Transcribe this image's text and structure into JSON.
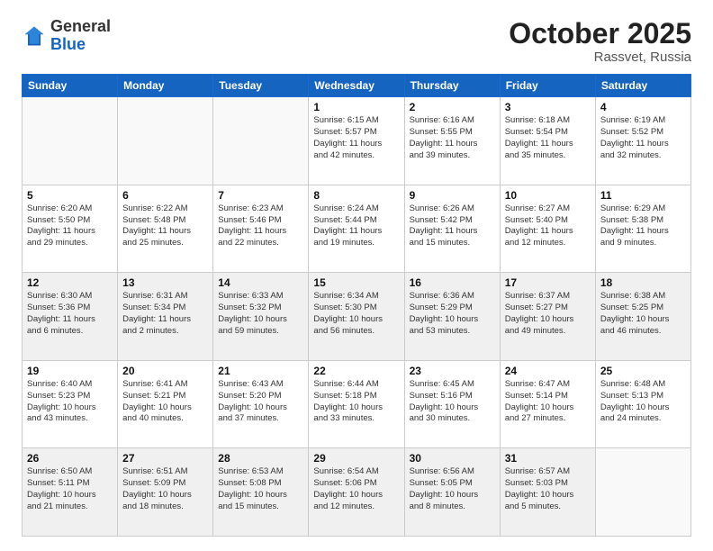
{
  "header": {
    "logo_general": "General",
    "logo_blue": "Blue",
    "month": "October 2025",
    "location": "Rassvet, Russia"
  },
  "weekdays": [
    "Sunday",
    "Monday",
    "Tuesday",
    "Wednesday",
    "Thursday",
    "Friday",
    "Saturday"
  ],
  "weeks": [
    [
      {
        "day": "",
        "text": "",
        "empty": true
      },
      {
        "day": "",
        "text": "",
        "empty": true
      },
      {
        "day": "",
        "text": "",
        "empty": true
      },
      {
        "day": "1",
        "text": "Sunrise: 6:15 AM\nSunset: 5:57 PM\nDaylight: 11 hours\nand 42 minutes."
      },
      {
        "day": "2",
        "text": "Sunrise: 6:16 AM\nSunset: 5:55 PM\nDaylight: 11 hours\nand 39 minutes."
      },
      {
        "day": "3",
        "text": "Sunrise: 6:18 AM\nSunset: 5:54 PM\nDaylight: 11 hours\nand 35 minutes."
      },
      {
        "day": "4",
        "text": "Sunrise: 6:19 AM\nSunset: 5:52 PM\nDaylight: 11 hours\nand 32 minutes."
      }
    ],
    [
      {
        "day": "5",
        "text": "Sunrise: 6:20 AM\nSunset: 5:50 PM\nDaylight: 11 hours\nand 29 minutes."
      },
      {
        "day": "6",
        "text": "Sunrise: 6:22 AM\nSunset: 5:48 PM\nDaylight: 11 hours\nand 25 minutes."
      },
      {
        "day": "7",
        "text": "Sunrise: 6:23 AM\nSunset: 5:46 PM\nDaylight: 11 hours\nand 22 minutes."
      },
      {
        "day": "8",
        "text": "Sunrise: 6:24 AM\nSunset: 5:44 PM\nDaylight: 11 hours\nand 19 minutes."
      },
      {
        "day": "9",
        "text": "Sunrise: 6:26 AM\nSunset: 5:42 PM\nDaylight: 11 hours\nand 15 minutes."
      },
      {
        "day": "10",
        "text": "Sunrise: 6:27 AM\nSunset: 5:40 PM\nDaylight: 11 hours\nand 12 minutes."
      },
      {
        "day": "11",
        "text": "Sunrise: 6:29 AM\nSunset: 5:38 PM\nDaylight: 11 hours\nand 9 minutes."
      }
    ],
    [
      {
        "day": "12",
        "text": "Sunrise: 6:30 AM\nSunset: 5:36 PM\nDaylight: 11 hours\nand 6 minutes."
      },
      {
        "day": "13",
        "text": "Sunrise: 6:31 AM\nSunset: 5:34 PM\nDaylight: 11 hours\nand 2 minutes."
      },
      {
        "day": "14",
        "text": "Sunrise: 6:33 AM\nSunset: 5:32 PM\nDaylight: 10 hours\nand 59 minutes."
      },
      {
        "day": "15",
        "text": "Sunrise: 6:34 AM\nSunset: 5:30 PM\nDaylight: 10 hours\nand 56 minutes."
      },
      {
        "day": "16",
        "text": "Sunrise: 6:36 AM\nSunset: 5:29 PM\nDaylight: 10 hours\nand 53 minutes."
      },
      {
        "day": "17",
        "text": "Sunrise: 6:37 AM\nSunset: 5:27 PM\nDaylight: 10 hours\nand 49 minutes."
      },
      {
        "day": "18",
        "text": "Sunrise: 6:38 AM\nSunset: 5:25 PM\nDaylight: 10 hours\nand 46 minutes."
      }
    ],
    [
      {
        "day": "19",
        "text": "Sunrise: 6:40 AM\nSunset: 5:23 PM\nDaylight: 10 hours\nand 43 minutes."
      },
      {
        "day": "20",
        "text": "Sunrise: 6:41 AM\nSunset: 5:21 PM\nDaylight: 10 hours\nand 40 minutes."
      },
      {
        "day": "21",
        "text": "Sunrise: 6:43 AM\nSunset: 5:20 PM\nDaylight: 10 hours\nand 37 minutes."
      },
      {
        "day": "22",
        "text": "Sunrise: 6:44 AM\nSunset: 5:18 PM\nDaylight: 10 hours\nand 33 minutes."
      },
      {
        "day": "23",
        "text": "Sunrise: 6:45 AM\nSunset: 5:16 PM\nDaylight: 10 hours\nand 30 minutes."
      },
      {
        "day": "24",
        "text": "Sunrise: 6:47 AM\nSunset: 5:14 PM\nDaylight: 10 hours\nand 27 minutes."
      },
      {
        "day": "25",
        "text": "Sunrise: 6:48 AM\nSunset: 5:13 PM\nDaylight: 10 hours\nand 24 minutes."
      }
    ],
    [
      {
        "day": "26",
        "text": "Sunrise: 6:50 AM\nSunset: 5:11 PM\nDaylight: 10 hours\nand 21 minutes."
      },
      {
        "day": "27",
        "text": "Sunrise: 6:51 AM\nSunset: 5:09 PM\nDaylight: 10 hours\nand 18 minutes."
      },
      {
        "day": "28",
        "text": "Sunrise: 6:53 AM\nSunset: 5:08 PM\nDaylight: 10 hours\nand 15 minutes."
      },
      {
        "day": "29",
        "text": "Sunrise: 6:54 AM\nSunset: 5:06 PM\nDaylight: 10 hours\nand 12 minutes."
      },
      {
        "day": "30",
        "text": "Sunrise: 6:56 AM\nSunset: 5:05 PM\nDaylight: 10 hours\nand 8 minutes."
      },
      {
        "day": "31",
        "text": "Sunrise: 6:57 AM\nSunset: 5:03 PM\nDaylight: 10 hours\nand 5 minutes."
      },
      {
        "day": "",
        "text": "",
        "empty": true
      }
    ]
  ]
}
